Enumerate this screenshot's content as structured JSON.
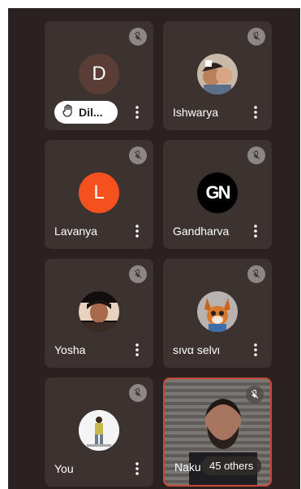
{
  "tiles": [
    {
      "name": "Dil...",
      "initial": "D",
      "avatar_color": "#5a3e36",
      "raised_hand": true
    },
    {
      "name": "Ishwarya",
      "avatar_type": "photo"
    },
    {
      "name": "Lavanya",
      "initial": "L",
      "avatar_color": "#f4511e"
    },
    {
      "name": "Gandharva",
      "initial": "GN",
      "avatar_color": "#000000"
    },
    {
      "name": "Yosha",
      "avatar_type": "photo"
    },
    {
      "name": "sıvα selvι",
      "avatar_type": "photo"
    },
    {
      "name": "You",
      "avatar_type": "photo"
    },
    {
      "name": "Naku",
      "video": true,
      "others_label": "45 others"
    }
  ],
  "icons": {
    "mute": "mic-off-icon",
    "more": "more-vert-icon",
    "hand": "raised-hand-icon"
  },
  "colors": {
    "background": "#2a2120",
    "tile": "#3c3331",
    "active_speaker_border": "#c9483a"
  }
}
